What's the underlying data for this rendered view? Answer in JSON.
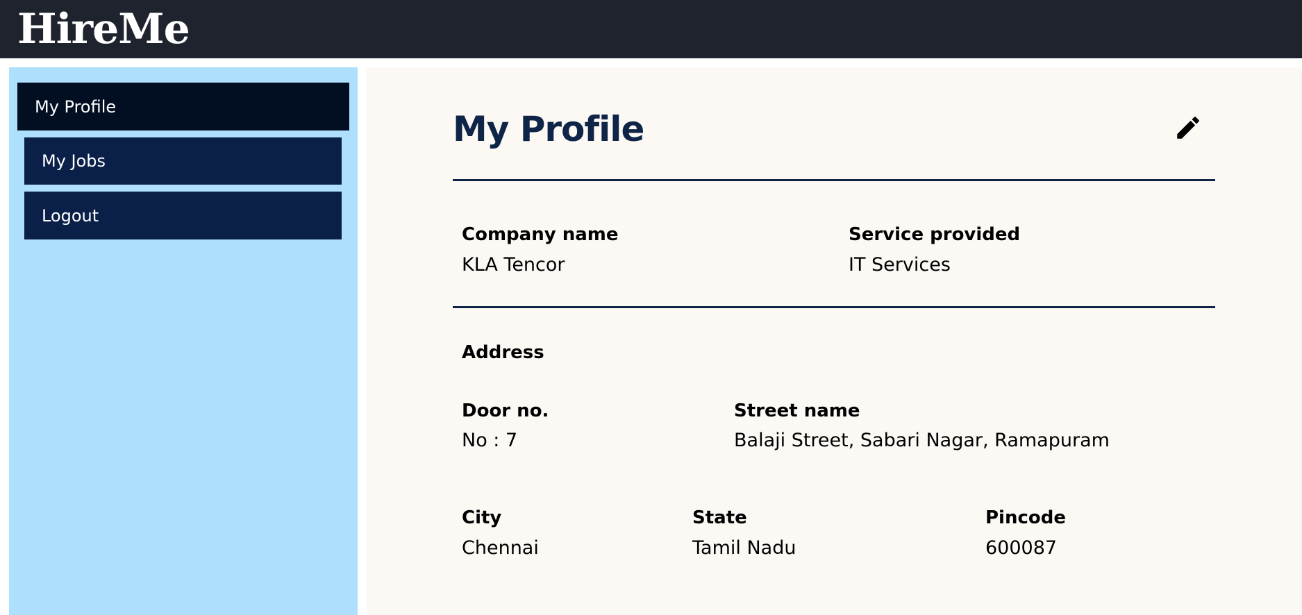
{
  "app": {
    "brand": "HireMe"
  },
  "sidebar": {
    "items": [
      {
        "label": "My Profile",
        "active": true
      },
      {
        "label": "My Jobs",
        "active": false
      },
      {
        "label": "Logout",
        "active": false
      }
    ]
  },
  "profile": {
    "title": "My Profile",
    "edit_icon": "pencil-icon",
    "company_name_label": "Company name",
    "company_name": "KLA Tencor",
    "service_label": "Service provided",
    "service": "IT Services",
    "address_heading": "Address",
    "door_label": "Door no.",
    "door": "No : 7",
    "street_label": "Street name",
    "street": "Balaji Street, Sabari Nagar, Ramapuram",
    "city_label": "City",
    "city": "Chennai",
    "state_label": "State",
    "state": "Tamil Nadu",
    "pincode_label": "Pincode",
    "pincode": "600087"
  },
  "colors": {
    "topbar": "#1e232e",
    "sidebar": "#aedffc",
    "nav_active": "#020e22",
    "nav_item": "#0b2048",
    "main_bg": "#fcf9f5",
    "accent": "#0f2548"
  }
}
